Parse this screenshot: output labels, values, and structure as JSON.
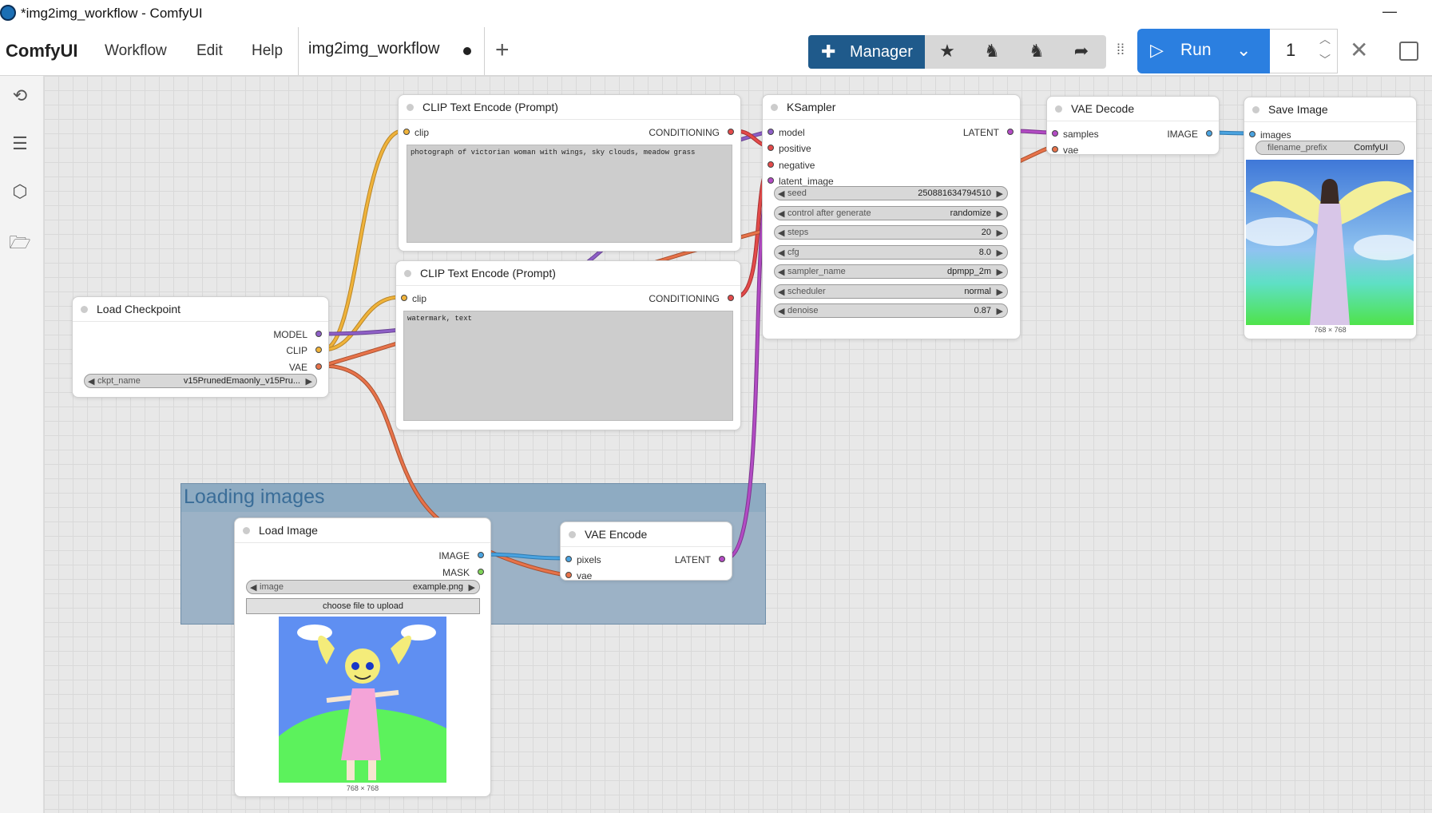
{
  "window": {
    "title": "*img2img_workflow - ComfyUI"
  },
  "menubar": {
    "brand": "ComfyUI",
    "items": [
      "Workflow",
      "Edit",
      "Help"
    ],
    "tab_label": "img2img_workflow",
    "manager_label": "Manager",
    "run_label": "Run",
    "queue_count": "1"
  },
  "group": {
    "title": "Loading images"
  },
  "nodes": {
    "clip_pos": {
      "title": "CLIP Text Encode (Prompt)",
      "in_clip": "clip",
      "out": "CONDITIONING",
      "text": "photograph of victorian woman with wings, sky clouds, meadow grass"
    },
    "clip_neg": {
      "title": "CLIP Text Encode (Prompt)",
      "in_clip": "clip",
      "out": "CONDITIONING",
      "text": "watermark, text"
    },
    "ksampler": {
      "title": "KSampler",
      "inputs": [
        "model",
        "positive",
        "negative",
        "latent_image"
      ],
      "out": "LATENT",
      "widgets": [
        {
          "name": "seed",
          "value": "250881634794510"
        },
        {
          "name": "control after generate",
          "value": "randomize"
        },
        {
          "name": "steps",
          "value": "20"
        },
        {
          "name": "cfg",
          "value": "8.0"
        },
        {
          "name": "sampler_name",
          "value": "dpmpp_2m"
        },
        {
          "name": "scheduler",
          "value": "normal"
        },
        {
          "name": "denoise",
          "value": "0.87"
        }
      ]
    },
    "vae_decode": {
      "title": "VAE Decode",
      "in_samples": "samples",
      "in_vae": "vae",
      "out": "IMAGE"
    },
    "save_image": {
      "title": "Save Image",
      "in_images": "images",
      "prefix_name": "filename_prefix",
      "prefix_value": "ComfyUI",
      "size": "768 × 768"
    },
    "load_checkpoint": {
      "title": "Load Checkpoint",
      "out_model": "MODEL",
      "out_clip": "CLIP",
      "out_vae": "VAE",
      "ckpt_name": "ckpt_name",
      "ckpt_value": "v15PrunedEmaonly_v15Pru..."
    },
    "load_image": {
      "title": "Load Image",
      "out_image": "IMAGE",
      "out_mask": "MASK",
      "image_name": "image",
      "image_value": "example.png",
      "upload_label": "choose file to upload",
      "size": "768 × 768"
    },
    "vae_encode": {
      "title": "VAE Encode",
      "in_pixels": "pixels",
      "in_vae": "vae",
      "out": "LATENT"
    }
  },
  "colors": {
    "clip": "#f0b33a",
    "model": "#8e5fc7",
    "vae": "#e8734a",
    "conditioning": "#e44a4a",
    "latent": "#b34bc4",
    "image": "#4aa3e0",
    "mask": "#7fd357"
  }
}
